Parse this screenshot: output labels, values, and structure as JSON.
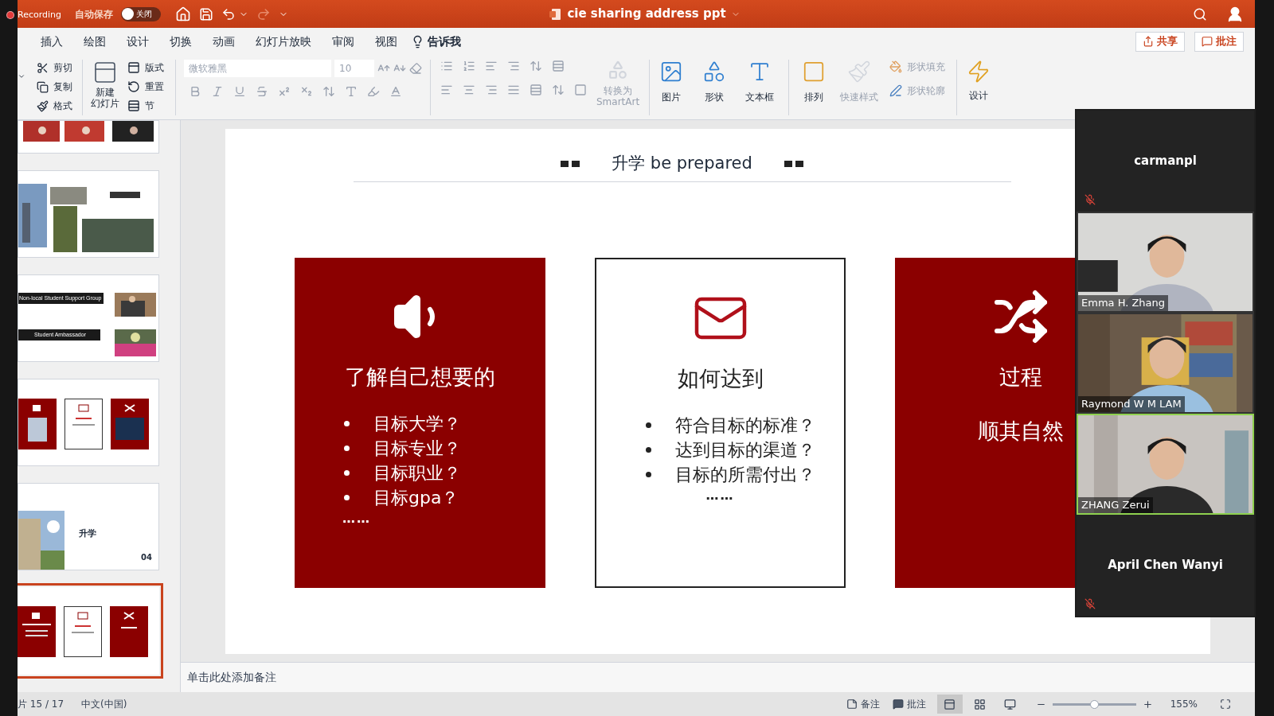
{
  "recording": {
    "label": "Recording"
  },
  "title_bar": {
    "autosave_label": "自动保存",
    "autosave": {
      "on": false,
      "label": "关闭"
    },
    "title": "cie sharing address ppt"
  },
  "menu_tabs": [
    "插入",
    "绘图",
    "设计",
    "切换",
    "动画",
    "幻灯片放映",
    "审阅",
    "视图"
  ],
  "tell_me": "告诉我",
  "share_button": "共享",
  "comments_button": "批注",
  "ribbon": {
    "clipboard": [
      "剪切",
      "复制",
      "格式"
    ],
    "new_slide": [
      "新建",
      "幻灯片"
    ],
    "slide_tools": [
      "版式",
      "重置",
      "节"
    ],
    "font": {
      "name": "微软雅黑",
      "size": "10",
      "disabled": true
    },
    "smartart": {
      "lines": [
        "转换为",
        "SmartArt"
      ],
      "disabled": true
    },
    "insert": [
      "图片",
      "形状",
      "文本框"
    ],
    "arrange": {
      "label": "排列",
      "disabled": false
    },
    "quick_styles": {
      "label": "快速样式",
      "disabled": true
    },
    "shape_fill": {
      "label": "形状填充",
      "disabled": true
    },
    "shape_outline": {
      "label": "形状轮廓",
      "disabled": true
    },
    "design": "设计"
  },
  "thumbnails": [
    {
      "kind": "photos",
      "selected": false
    },
    {
      "kind": "collage",
      "selected": false
    },
    {
      "kind": "support",
      "selected": false,
      "texts": [
        "Non-local Student Support Group",
        "Student Ambassador"
      ]
    },
    {
      "kind": "cards",
      "selected": false
    },
    {
      "kind": "section",
      "selected": false,
      "texts": [
        "升学",
        "04"
      ]
    },
    {
      "kind": "current",
      "selected": true
    }
  ],
  "slide": {
    "title": "升学 be prepared",
    "cards": [
      {
        "kind": "filled",
        "heading": "了解自己想要的",
        "bullets": [
          "目标大学？",
          "目标专业？",
          "目标职业？",
          "目标gpa？"
        ],
        "ellipsis": "……"
      },
      {
        "kind": "outlined",
        "heading": "如何达到",
        "bullets": [
          "符合目标的标准？",
          "达到目标的渠道？",
          "目标的所需付出？"
        ],
        "ellipsis": "……"
      },
      {
        "kind": "filled",
        "heading": "过程",
        "subtitle": "顺其自然"
      }
    ]
  },
  "notes": {
    "placeholder": "单击此处添加备注"
  },
  "status_bar": {
    "slide_counter": "片 15 / 17",
    "language": "中文(中国)",
    "notes": "备注",
    "comments": "批注",
    "views": [
      {
        "selected": true
      },
      {
        "selected": false
      },
      {
        "selected": false
      }
    ],
    "zoom_slider": {
      "level": 0.5
    },
    "zoom": "155%"
  },
  "participants": [
    {
      "name": "carmanpl",
      "kind": "name",
      "muted": true,
      "active": false
    },
    {
      "name": "Emma H. Zhang",
      "kind": "video",
      "muted": false,
      "active": false
    },
    {
      "name": "Raymond W M LAM",
      "kind": "video",
      "muted": false,
      "active": false
    },
    {
      "name": "ZHANG Zerui",
      "kind": "video",
      "muted": false,
      "active": true
    },
    {
      "name": "April Chen Wanyi",
      "kind": "name",
      "muted": true,
      "active": false
    }
  ]
}
